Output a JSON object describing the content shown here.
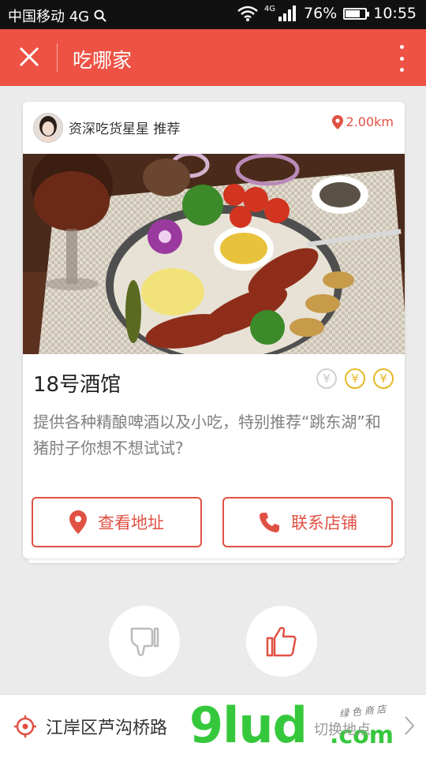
{
  "status_bar": {
    "carrier": "中国移动 4G",
    "network_small": "4G",
    "battery": "76%",
    "battery_level": 0.76,
    "time": "10:55"
  },
  "header": {
    "title": "吃哪家"
  },
  "card": {
    "recommender": "资深吃货星星 推荐",
    "distance": "2.00km",
    "shop_name": "18号酒馆",
    "price_level": 2,
    "price_max": 3,
    "price_symbol": "¥",
    "description": "提供各种精酿啤酒以及小吃，特别推荐“跳东湖”和猪肘子你想不想试试?",
    "address_button": "查看地址",
    "contact_button": "联系店铺"
  },
  "location": {
    "current": "江岸区芦沟桥路",
    "switch_label": "切换地点"
  },
  "watermark": {
    "main": "9lud",
    "tld": ".com",
    "small": "绿 色 商 店"
  },
  "colors": {
    "accent": "#ed5244",
    "button_red": "#e05143",
    "price_gold": "#e7b826",
    "watermark_green": "#36c83c"
  }
}
